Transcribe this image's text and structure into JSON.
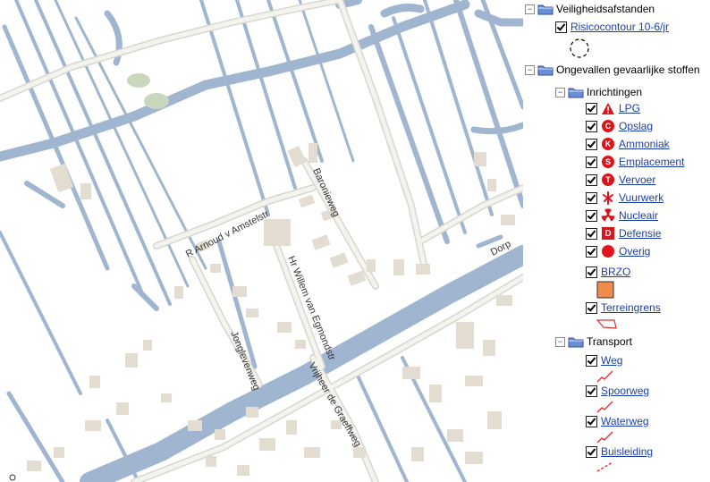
{
  "map": {
    "roads": [
      "Baronieweg",
      "R Arnoud v Amstelstr",
      "Hr Willem van Egmondstr",
      "Jonglevenweg",
      "Vrijheer de Graeffweg",
      "Dorp"
    ],
    "colors": {
      "land": "#ffffff",
      "water": "#9fb5d0",
      "road_edge": "#d7d7cf",
      "road_fill": "#f4f4ef",
      "building": "#e3ddd1",
      "vegetation": "#c9d8bd"
    }
  },
  "legend": {
    "groups": [
      {
        "label": "Veiligheidsafstanden",
        "icon": "folder-icon"
      },
      {
        "label": "Ongevallen gevaarlijke stoffen",
        "icon": "folder-icon"
      }
    ],
    "risk": {
      "label": "Risicocontour 10-6/jr",
      "symbol": "dashed-circle-icon"
    },
    "inrichtingen": {
      "label": "Inrichtingen",
      "items": [
        {
          "label": "LPG",
          "icon": "warning-triangle-icon"
        },
        {
          "label": "Opslag",
          "icon": "C"
        },
        {
          "label": "Ammoniak",
          "icon": "K"
        },
        {
          "label": "Emplacement",
          "icon": "S"
        },
        {
          "label": "Vervoer",
          "icon": "T"
        },
        {
          "label": "Vuurwerk",
          "icon": "firework-icon"
        },
        {
          "label": "Nucleair",
          "icon": "radiation-icon"
        },
        {
          "label": "Defensie",
          "icon": "D"
        },
        {
          "label": "Overig",
          "icon": "red-dot-icon"
        }
      ]
    },
    "brzo": {
      "label": "BRZO",
      "color": "#f28a4b"
    },
    "terreingrens": {
      "label": "Terreingrens",
      "color": "#e03030"
    },
    "transport": {
      "label": "Transport",
      "items": [
        {
          "label": "Weg",
          "line": "solid"
        },
        {
          "label": "Spoorweg",
          "line": "solid"
        },
        {
          "label": "Waterweg",
          "line": "solid"
        },
        {
          "label": "Buisleiding",
          "line": "dashed"
        }
      ],
      "line_color": "#e03030"
    }
  }
}
